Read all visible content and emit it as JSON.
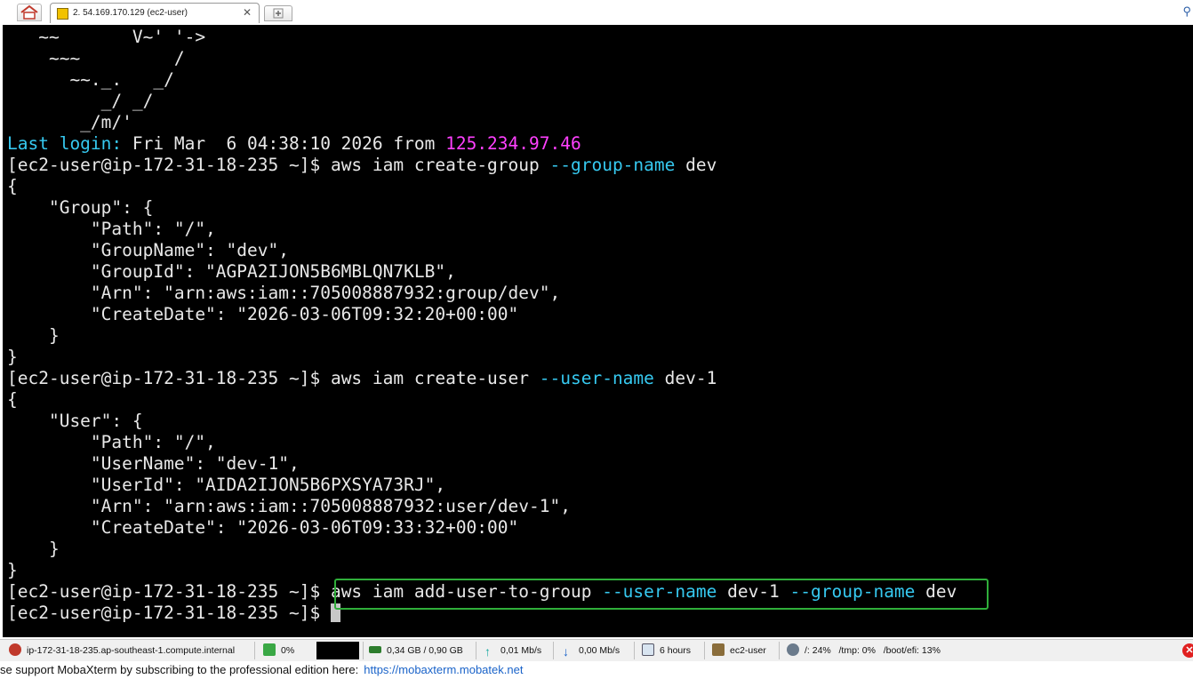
{
  "tab": {
    "title": "2. 54.169.170.129 (ec2-user)",
    "close_glyph": "✕"
  },
  "terminal": {
    "banner": [
      "   ~~       V~' '->",
      "    ~~~         /",
      "      ~~._.   _/",
      "         _/ _/",
      "       _/m/'"
    ],
    "last_login": {
      "label": "Last login:",
      "text": " Fri Mar  6 04:38:10 2026 from ",
      "ip": "125.234.97.46"
    },
    "prompt": "[ec2-user@ip-172-31-18-235 ~]$ ",
    "cmd1": {
      "base": "aws iam create-group ",
      "flag": "--group-name",
      "arg": " dev"
    },
    "group_output": [
      "{",
      "    \"Group\": {",
      "        \"Path\": \"/\",",
      "        \"GroupName\": \"dev\",",
      "        \"GroupId\": \"AGPA2IJON5B6MBLQN7KLB\",",
      "        \"Arn\": \"arn:aws:iam::705008887932:group/dev\",",
      "        \"CreateDate\": \"2026-03-06T09:32:20+00:00\"",
      "    }",
      "}"
    ],
    "cmd2": {
      "base": "aws iam create-user ",
      "flag": "--user-name",
      "arg": " dev-1"
    },
    "user_output": [
      "{",
      "    \"User\": {",
      "        \"Path\": \"/\",",
      "        \"UserName\": \"dev-1\",",
      "        \"UserId\": \"AIDA2IJON5B6PXSYA73RJ\",",
      "        \"Arn\": \"arn:aws:iam::705008887932:user/dev-1\",",
      "        \"CreateDate\": \"2026-03-06T09:33:32+00:00\"",
      "    }",
      "}"
    ],
    "cmd3": {
      "base": "aws iam add-user-to-group ",
      "flag1": "--user-name",
      "arg1": " dev-1 ",
      "flag2": "--group-name",
      "arg2": " dev"
    }
  },
  "statusbar": {
    "host": "ip-172-31-18-235.ap-southeast-1.compute.internal",
    "cpu": "0%",
    "memory": "0,34 GB / 0,90 GB",
    "upload": "0,01 Mb/s",
    "download": "0,00 Mb/s",
    "uptime": "6 hours",
    "user": "ec2-user",
    "disk": "/: 24%   /tmp: 0%   /boot/efi: 13%"
  },
  "footer": {
    "text": "se support MobaXterm by subscribing to the professional edition here:",
    "link": "https://mobaxterm.mobatek.net"
  },
  "colors": {
    "terminal_bg": "#000000",
    "cyan": "#36c9f0",
    "magenta": "#ff40ff",
    "highlight": "#2fae3a"
  }
}
